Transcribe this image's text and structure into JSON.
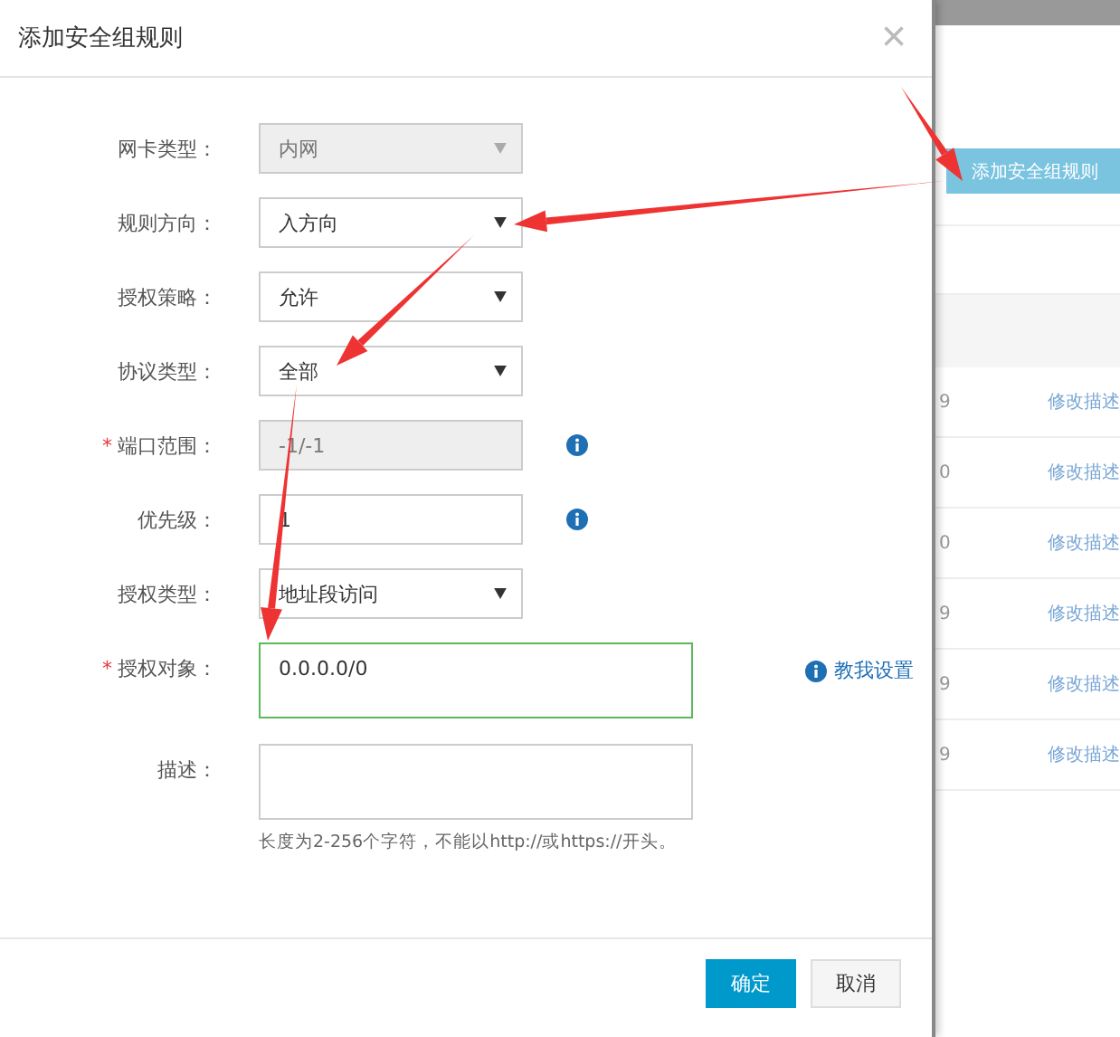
{
  "dialog": {
    "title": "添加安全组规则",
    "close": "×",
    "fields": [
      {
        "label": "网卡类型：",
        "kind": "select",
        "value": "内网",
        "disabled": true
      },
      {
        "label": "规则方向：",
        "kind": "select",
        "value": "入方向",
        "disabled": false
      },
      {
        "label": "授权策略：",
        "kind": "select",
        "value": "允许",
        "disabled": false
      },
      {
        "label": "协议类型：",
        "kind": "select",
        "value": "全部",
        "disabled": false
      },
      {
        "label": "端口范围：",
        "kind": "input",
        "value": "-1/-1",
        "disabled": true,
        "required_mark": "*",
        "info": true
      },
      {
        "label": "优先级：",
        "kind": "input",
        "value": "1",
        "disabled": false,
        "info": true
      },
      {
        "label": "授权类型：",
        "kind": "select",
        "value": "地址段访问",
        "disabled": false
      },
      {
        "label": "授权对象：",
        "kind": "textarea",
        "value": "0.0.0.0/0",
        "disabled": false,
        "required_mark": "*",
        "focused": true,
        "help": "教我设置"
      },
      {
        "label": "描述：",
        "kind": "textarea",
        "disabled": false,
        "focused": false,
        "hint": "长度为2-256个字符，不能以http://或https://开头。"
      }
    ],
    "buttons": [
      {
        "label": "确定",
        "primary": true
      },
      {
        "label": "取消",
        "primary": false
      }
    ]
  },
  "background": {
    "button": "添加安全组规则",
    "rows": [
      {
        "number": "9",
        "link": "修改描述"
      },
      {
        "number": "0",
        "link": "修改描述"
      },
      {
        "number": "0",
        "link": "修改描述"
      },
      {
        "number": "9",
        "link": "修改描述"
      },
      {
        "number": "9",
        "link": "修改描述"
      },
      {
        "number": "9",
        "link": "修改描述"
      }
    ]
  }
}
